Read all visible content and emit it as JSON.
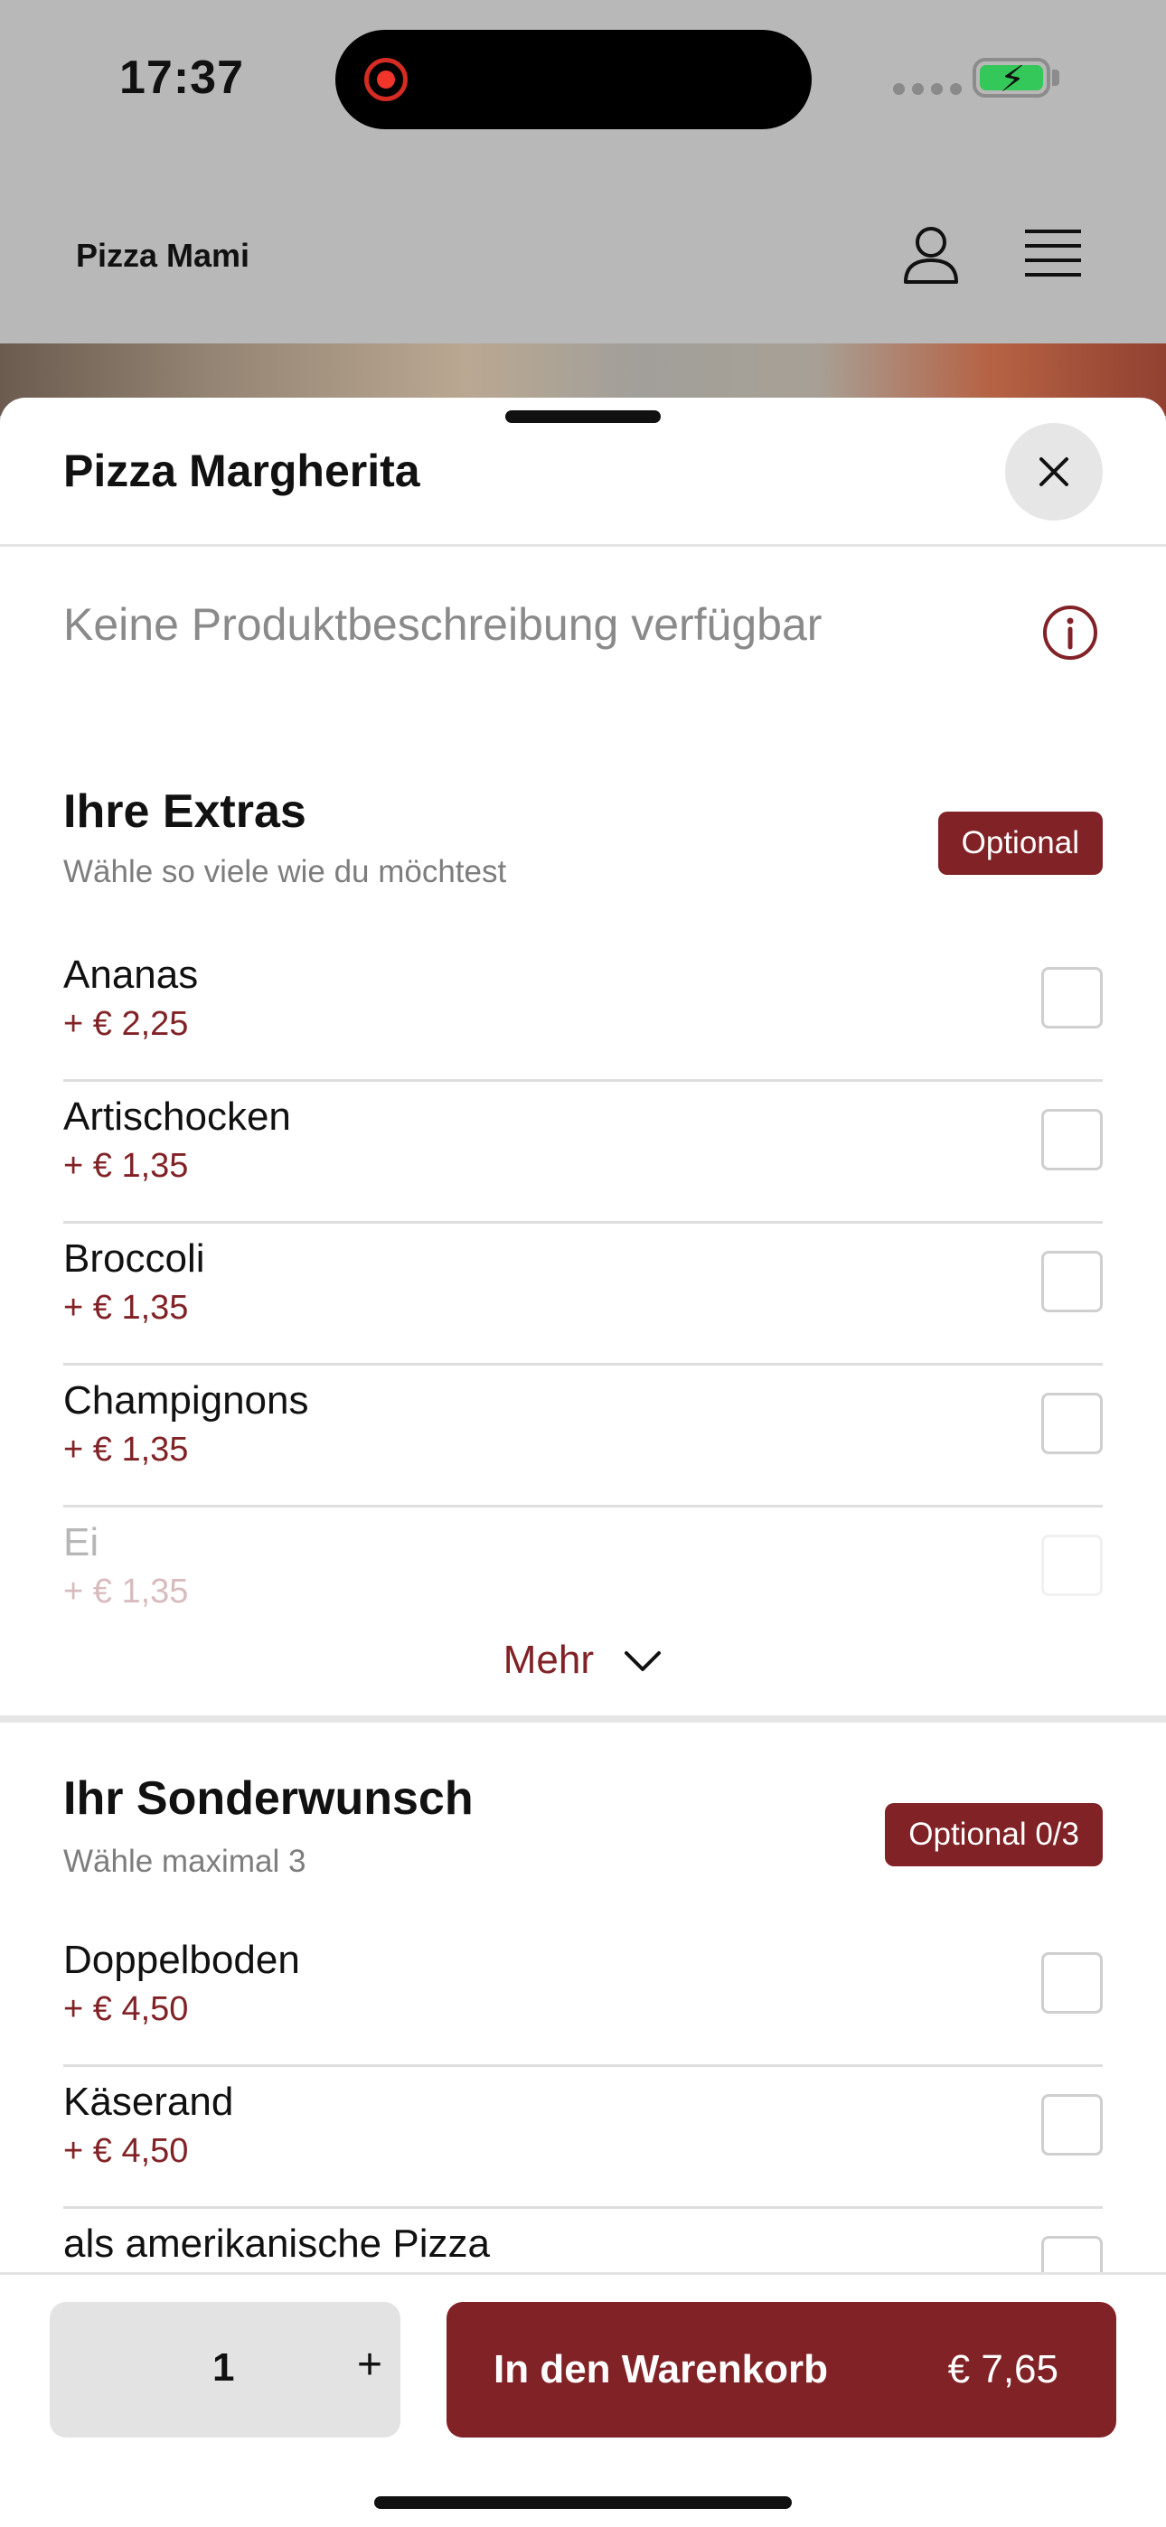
{
  "status": {
    "time": "17:37"
  },
  "app": {
    "brand": "Pizza Mami"
  },
  "sheet": {
    "title": "Pizza Margherita",
    "description": "Keine Produktbeschreibung verfügbar"
  },
  "extras": {
    "title": "Ihre Extras",
    "subtitle": "Wähle so viele wie du möchtest",
    "badge": "Optional",
    "items": [
      {
        "name": "Ananas",
        "price": "+ € 2,25",
        "checked": false
      },
      {
        "name": "Artischocken",
        "price": "+ € 1,35",
        "checked": false
      },
      {
        "name": "Broccoli",
        "price": "+ € 1,35",
        "checked": false
      },
      {
        "name": "Champignons",
        "price": "+ € 1,35",
        "checked": false
      },
      {
        "name": "Ei",
        "price": "+ € 1,35",
        "checked": false
      }
    ],
    "more_label": "Mehr"
  },
  "special": {
    "title": "Ihr Sonderwunsch",
    "subtitle": "Wähle maximal 3",
    "badge": "Optional 0/3",
    "items": [
      {
        "name": "Doppelboden",
        "price": "+ € 4,50",
        "checked": false
      },
      {
        "name": "Käserand",
        "price": "+ € 4,50",
        "checked": false
      },
      {
        "name": "als amerikanische Pizza",
        "checked": false
      }
    ]
  },
  "footer": {
    "quantity": "1",
    "plus_label": "+",
    "cart_label": "In den Warenkorb",
    "cart_price": "€ 7,65"
  },
  "colors": {
    "accent": "#812226",
    "dim": "#b8b8b8"
  }
}
